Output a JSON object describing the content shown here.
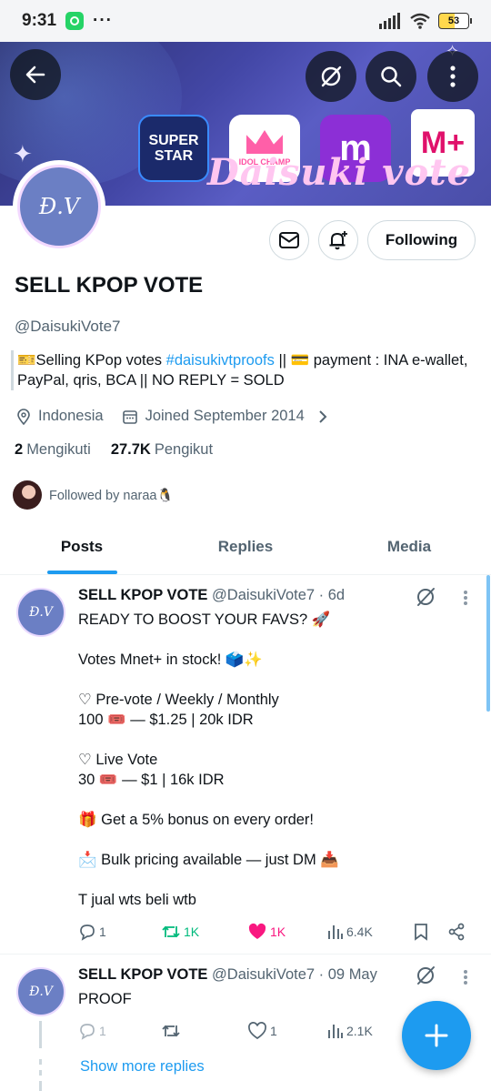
{
  "status_bar": {
    "time": "9:31",
    "dots": "···",
    "battery": "53"
  },
  "banner": {
    "tiles": {
      "superstar": "SUPER STAR",
      "idolchamp": "IDOL CHAMP",
      "m": "m",
      "mnet": "M+"
    },
    "script_text": "Daisuki vote"
  },
  "profile": {
    "avatar_text": "Đ.V",
    "following_label": "Following",
    "name": "SELL KPOP VOTE",
    "handle": "@DaisukiVote7",
    "bio_prefix": "🎫Selling KPop votes ",
    "bio_link": "#daisukivtproofs",
    "bio_suffix": " || 💳 payment : INA e-wallet, PayPal, qris, BCA || NO REPLY = SOLD",
    "location": "Indonesia",
    "joined": "Joined September 2014",
    "following_count": "2",
    "following_text": "Mengikuti",
    "followers_count": "27.7K",
    "followers_text": "Pengikut",
    "followed_by": "Followed by naraa🐧"
  },
  "tabs": [
    "Posts",
    "Replies",
    "Media"
  ],
  "posts": [
    {
      "name": "SELL KPOP VOTE",
      "meta": "@DaisukiVote7 · 6d",
      "lines": [
        "READY TO BOOST YOUR FAVS? 🚀",
        "",
        "Votes Mnet+ in stock! 🗳️✨",
        "",
        "♡ Pre-vote / Weekly / Monthly",
        "100 🎟️ — $1.25 | 20k IDR",
        "",
        "♡ Live Vote",
        "30 🎟️ — $1 | 16k IDR",
        "",
        "🎁 Get a 5% bonus on every order!",
        "",
        "📩 Bulk pricing available — just DM 📥",
        "",
        "T jual wts beli wtb"
      ],
      "replies": "1",
      "reposts": "1K",
      "likes": "1K",
      "views": "6.4K"
    },
    {
      "name": "SELL KPOP VOTE",
      "meta": "@DaisukiVote7 · 09 May",
      "lines": [
        "PROOF"
      ],
      "replies": "1",
      "reposts": "",
      "likes": "1",
      "views": "2.1K"
    }
  ],
  "show_more": "Show more replies",
  "colors": {
    "accent": "#1d9bf0",
    "like": "#f91880",
    "repost": "#00ba7c",
    "text": "#0f1419",
    "muted": "#536471"
  }
}
